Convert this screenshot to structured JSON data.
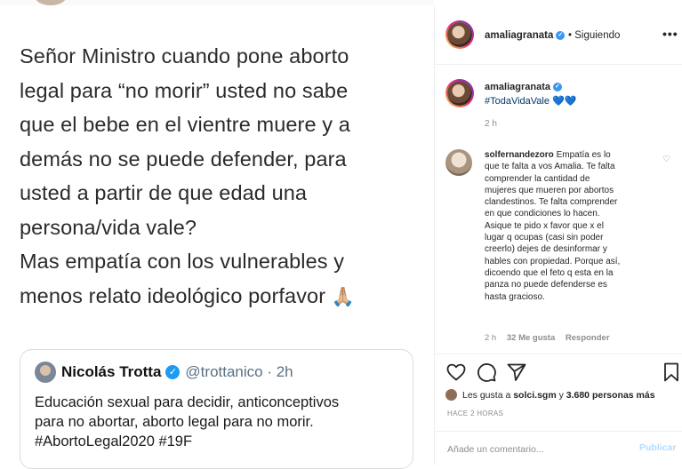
{
  "post_image": {
    "text_lines": [
      "Señor Ministro cuando pone aborto",
      "legal para “no morir” usted no sabe",
      "que el bebe en el vientre muere y a",
      "demás no se puede defender, para",
      "usted a partir de que edad una",
      "persona/vida vale?",
      "Mas empatía con los vulnerables y",
      "menos relato ideológico porfavor"
    ],
    "pray_emoji": "🙏🏼",
    "tweet": {
      "name": "Nicolás Trotta",
      "handle": "@trottanico · 2h",
      "lines": [
        "Educación sexual para decidir, anticonceptivos",
        "para no abortar, aborto legal para no morir.",
        "#AbortoLegal2020 #19F"
      ]
    }
  },
  "header": {
    "username": "amaliagranata",
    "following": "• Siguiendo",
    "more": "•••"
  },
  "caption": {
    "username": "amaliagranata",
    "hashtag": "#TodaVidaVale",
    "hearts": "💙💙",
    "time": "2 h"
  },
  "comment": {
    "username": "solfernandezoro",
    "lines": [
      "Empatía es lo",
      "que te falta a vos Amalia. Te falta",
      "comprender la cantidad de",
      "mujeres que mueren por abortos",
      "clandestinos. Te falta comprender",
      "en que condiciones lo hacen.",
      "Asique te pido x favor que x el",
      "lugar q ocupas (casi sin poder",
      "creerlo) dejes de desinformar y",
      "hables con propiedad. Porque así,",
      "dicoendo que el feto q esta en la",
      "panza no puede defenderse es",
      "hasta gracioso."
    ],
    "time": "2 h",
    "likes": "32 Me gusta",
    "reply": "Responder"
  },
  "actions": {
    "likes_prefix": "Les gusta a",
    "likes_user": "solci.sgm",
    "likes_mid": "y",
    "likes_count": "3.680 personas más",
    "date": "HACE 2 HORAS"
  },
  "comment_box": {
    "placeholder": "Añade un comentario...",
    "publish": "Publicar"
  },
  "colors": {
    "link": "#00376b",
    "muted": "#8e8e8e",
    "verified": "#3897f0",
    "publish_disabled": "#b3dbff"
  }
}
